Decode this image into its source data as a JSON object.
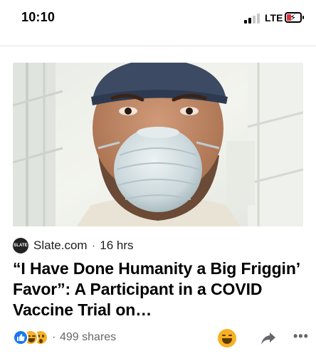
{
  "status_bar": {
    "time": "10:10",
    "network": "LTE",
    "icons": [
      "signal-icon",
      "battery-charging-icon"
    ]
  },
  "post": {
    "image": {
      "description_icon": "article-photo"
    },
    "source": {
      "logo_text": "SLATE",
      "name": "Slate.com",
      "separator": "·",
      "time": "16 hrs"
    },
    "headline": "“I Have Done Humanity a Big Friggin’ Favor”: A Participant in a COVID Vaccine Trial on…",
    "engagement": {
      "reactions": [
        "like-icon",
        "haha-icon",
        "wow-icon"
      ],
      "separator": "·",
      "shares": "499 shares",
      "actions": [
        "haha-reaction-icon",
        "share-arrow-icon",
        "more-icon"
      ],
      "more_label": "•••"
    }
  },
  "colors": {
    "facebook_blue": "#1877f2",
    "reaction_yellow": "#f7b125",
    "secondary_text": "#65676b",
    "battery_low": "#e0313a"
  }
}
